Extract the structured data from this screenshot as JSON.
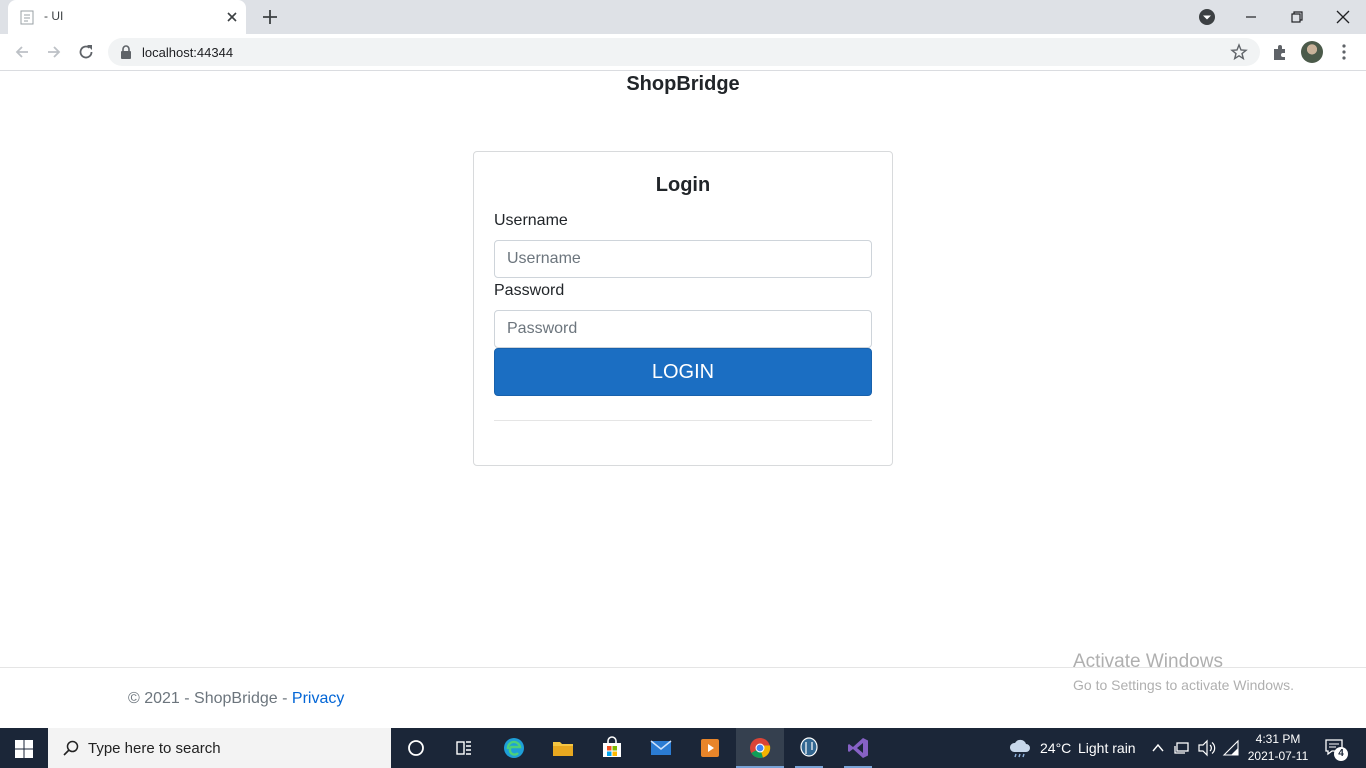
{
  "browser": {
    "tab_title": "- UI",
    "url": "localhost:44344"
  },
  "page": {
    "brand": "ShopBridge",
    "login": {
      "heading": "Login",
      "username_label": "Username",
      "username_placeholder": "Username",
      "username_value": "",
      "password_label": "Password",
      "password_placeholder": "Password",
      "password_value": "",
      "button_label": "LOGIN"
    },
    "footer": {
      "copyright": "© 2021 - ShopBridge - ",
      "privacy_link": "Privacy"
    }
  },
  "watermark": {
    "line1": "Activate Windows",
    "line2": "Go to Settings to activate Windows."
  },
  "taskbar": {
    "search_placeholder": "Type here to search",
    "weather_temp": "24°C",
    "weather_desc": "Light rain",
    "time": "4:31 PM",
    "date": "2021-07-11",
    "notification_count": "4"
  },
  "colors": {
    "primary_button": "#1b6ec2",
    "link": "#0366d6",
    "taskbar": "#1b2638"
  },
  "icons": [
    "page-favicon-icon",
    "close-icon",
    "plus-icon",
    "profile-menu-icon",
    "minimize-icon",
    "restore-icon",
    "back-icon",
    "forward-icon",
    "reload-icon",
    "lock-icon",
    "star-icon",
    "extensions-icon",
    "kebab-menu-icon",
    "windows-start-icon",
    "search-icon",
    "cortana-icon",
    "task-view-icon",
    "edge-icon",
    "file-explorer-icon",
    "store-icon",
    "mail-icon",
    "media-player-icon",
    "chrome-icon",
    "postgres-icon",
    "visual-studio-icon",
    "cloud-rain-icon",
    "chevron-up-icon",
    "network-icon",
    "volume-icon",
    "wifi-icon",
    "notification-icon"
  ]
}
